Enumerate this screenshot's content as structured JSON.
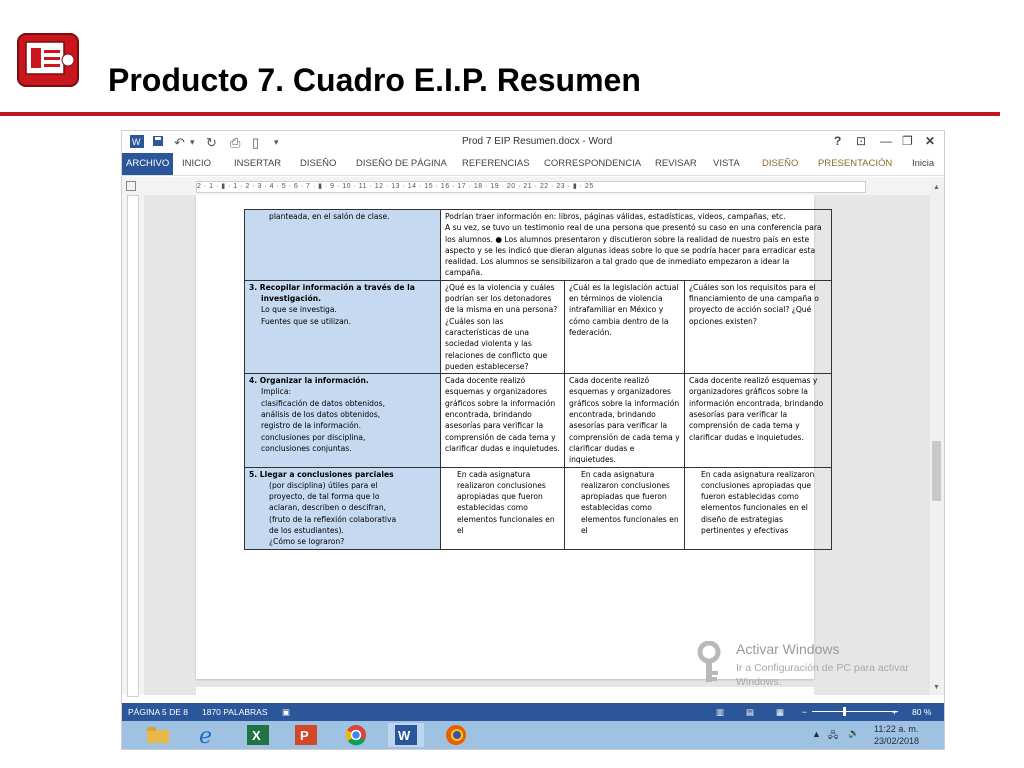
{
  "slide": {
    "title": "Producto 7. Cuadro E.I.P. Resumen"
  },
  "word": {
    "doc_title": "Prod 7 EIP Resumen.docx - Word",
    "qa_icons": [
      "word-logo-icon",
      "save-icon",
      "undo-icon",
      "redo-icon",
      "print-preview-icon",
      "new-doc-icon",
      "customize-icon"
    ],
    "window_controls": {
      "help": "?",
      "ribbon_options": "⊡",
      "minimize": "—",
      "restore": "❐",
      "close": "✕"
    },
    "tabs": [
      "ARCHIVO",
      "INICIO",
      "INSERTAR",
      "DISEÑO",
      "DISEÑO DE PÁGINA",
      "REFERENCIAS",
      "CORRESPONDENCIA",
      "REVISAR",
      "VISTA",
      "DISEÑO",
      "PRESENTACIÓN"
    ],
    "user": "Inicia",
    "ruler_text": "2 · 1 · ▮ · 1 · 2 · 3 · 4 · 5 · 6 · 7 · ▮ · 9 · 10 · 11 · 12 · 13 · 14 · 15 · 16 · 17 · 18 · 19 · 20 · 21 · 22 · 23 · ▮ · 25",
    "status": {
      "page": "PÁGINA 5 DE 8",
      "words": "1870 PALABRAS",
      "zoom": "80 %"
    }
  },
  "table": {
    "row1": {
      "label": "planteada, en el salón de clase.",
      "content": [
        "Podrían traer información en: libros, páginas válidas, estadísticas, videos, campañas, etc.",
        "A su vez, se tuvo un testimonio real de una persona que presentó su caso en una conferencia para los alumnos. ● Los alumnos presentaron y discutieron sobre la realidad de nuestro país en este aspecto y se les indicó que dieran algunas ideas sobre lo que se podría hacer para erradicar esta realidad. Los alumnos se sensibilizaron a tal grado que de inmediato empezaron a idear la campaña."
      ]
    },
    "row2": {
      "label_title": "3. Recopilar información a través de la",
      "label_title2": "investigación.",
      "label_lines": [
        "Lo que se investiga.",
        "Fuentes que se utilizan."
      ],
      "c1": "¿Qué es la violencia y cuáles podrían ser los detonadores de la misma en una persona? ¿Cuáles son las características de una sociedad violenta y las relaciones de conflicto que pueden establecerse?",
      "c2": "¿Cuál es la legislación actual en términos de violencia intrafamiliar en México y cómo cambia dentro de la federación.",
      "c3": "¿Cuáles son los requisitos para el financiamiento de una campaña o proyecto de acción social? ¿Qué opciones existen?"
    },
    "row3": {
      "label_title": "4. Organizar la información.",
      "label_lines": [
        "Implica:",
        "clasificación de datos obtenidos,",
        "análisis de los datos obtenidos,",
        "registro de la información.",
        "conclusiones por disciplina,",
        "conclusiones conjuntas."
      ],
      "c1": "Cada docente realizó esquemas y organizadores gráficos sobre la información encontrada, brindando asesorías para verificar la comprensión de cada tema y clarificar dudas e inquietudes.",
      "c2": "Cada docente realizó esquemas y organizadores gráficos sobre la información encontrada, brindando asesorías para verificar la comprensión de cada tema y clarificar dudas e inquietudes.",
      "c3": "Cada docente realizó esquemas y organizadores gráficos sobre la información encontrada, brindando asesorías para verificar la comprensión de cada tema y clarificar dudas e inquietudes."
    },
    "row4": {
      "label_title": "5. Llegar a conclusiones parciales",
      "label_lines": [
        "(por disciplina) útiles para el",
        "proyecto, de tal forma que lo",
        "aclaran, describen o descifran,",
        "(fruto de la reflexión colaborativa",
        "de los estudiantes).",
        "¿Cómo se lograron?"
      ],
      "c1": "En cada asignatura realizaron conclusiones apropiadas que fueron establecidas como elementos funcionales en el",
      "c2": "En cada asignatura realizaron conclusiones apropiadas que fueron establecidas como elementos funcionales en el",
      "c3": "En cada asignatura realizaron conclusiones apropiadas que fueron establecidas como elementos funcionales en el diseño de estrategias pertinentes y efectivas"
    }
  },
  "activate": {
    "title": "Activar Windows",
    "subtitle": "Ir a Configuración de PC para activar Windows."
  },
  "taskbar": {
    "apps": [
      "file-explorer-icon",
      "edge-icon",
      "excel-icon",
      "powerpoint-icon",
      "chrome-icon",
      "word-icon",
      "firefox-icon"
    ],
    "time": "11:22 a. m.",
    "date": "23/02/2018"
  }
}
